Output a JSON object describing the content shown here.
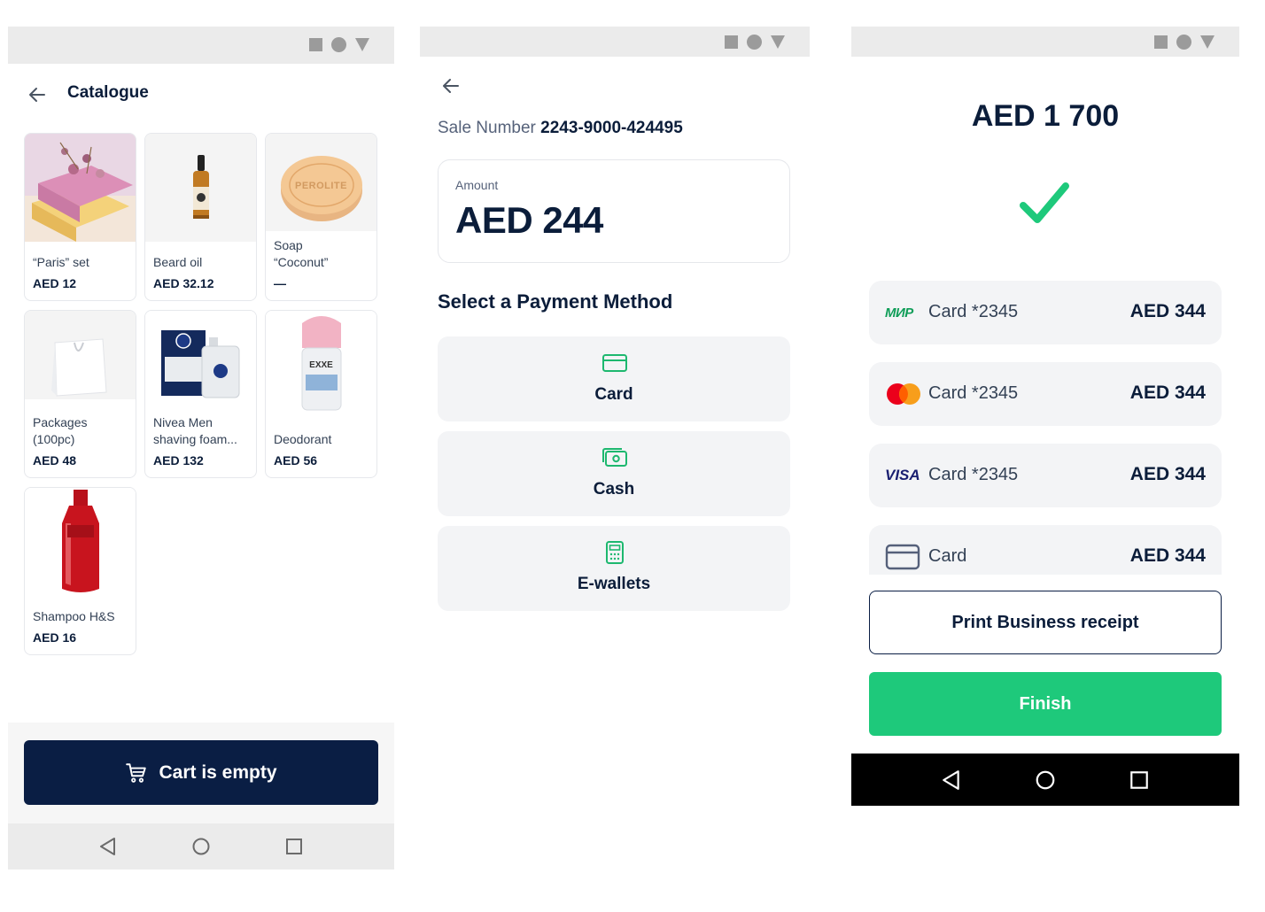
{
  "catalogue": {
    "title": "Catalogue",
    "products": [
      {
        "name_line1": "“Paris” set",
        "name_line2": "",
        "price": "AED 12"
      },
      {
        "name_line1": "Beard oil",
        "name_line2": "",
        "price": "AED 32.12"
      },
      {
        "name_line1": "Soap",
        "name_line2": "“Coconut”",
        "price": "—"
      },
      {
        "name_line1": "Packages",
        "name_line2": "(100pc)",
        "price": "AED 48"
      },
      {
        "name_line1": "Nivea Men",
        "name_line2": "shaving foam...",
        "price": "AED 132"
      },
      {
        "name_line1": "Deodorant",
        "name_line2": "",
        "price": "AED 56"
      },
      {
        "name_line1": "Shampoo H&S",
        "name_line2": "",
        "price": "AED 16"
      }
    ],
    "soap_brand": "PEROLITE",
    "deodorant_brand": "EXXE",
    "cart_label": "Cart is empty"
  },
  "payment": {
    "sale_label": "Sale Number",
    "sale_number": "2243-9000-424495",
    "amount_label": "Amount",
    "amount_value": "AED 244",
    "methods_title": "Select a Payment Method",
    "methods": [
      {
        "label": "Card",
        "icon": "card-icon"
      },
      {
        "label": "Cash",
        "icon": "cash-icon"
      },
      {
        "label": "E-wallets",
        "icon": "calculator-icon"
      }
    ]
  },
  "result": {
    "total": "AED 1 700",
    "payments": [
      {
        "brand": "МИР",
        "label": "Card *2345",
        "amount": "AED 344"
      },
      {
        "brand": "mastercard",
        "label": "Card *2345",
        "amount": "AED 344"
      },
      {
        "brand": "VISA",
        "label": "Card *2345",
        "amount": "AED 344"
      },
      {
        "brand": "generic-card",
        "label": "Card",
        "amount": "AED 344"
      }
    ],
    "print_label": "Print Business receipt",
    "finish_label": "Finish"
  },
  "colors": {
    "navy": "#0a1e44",
    "green": "#1ec97b",
    "icon_green": "#1db86f"
  }
}
